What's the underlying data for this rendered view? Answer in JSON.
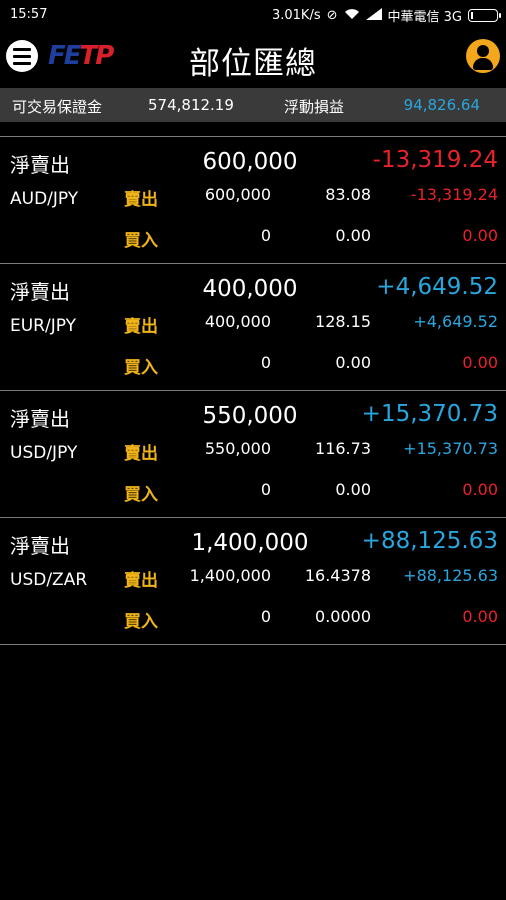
{
  "status_bar": {
    "time": "15:57",
    "speed": "3.01K/s",
    "carrier": "中華電信 3G"
  },
  "header": {
    "title": "部位匯總",
    "logo_text_a": "FE",
    "logo_text_b": "TP"
  },
  "summary": {
    "available_margin_label": "可交易保證金",
    "available_margin_value": "574,812.19",
    "floating_pl_label": "浮動損益",
    "floating_pl_value": "94,826.64"
  },
  "labels": {
    "net_sell": "淨賣出",
    "sell": "賣出",
    "buy": "買入"
  },
  "positions": [
    {
      "pair": "AUD/JPY",
      "net_qty": "600,000",
      "net_pl": "-13,319.24",
      "net_pl_color": "red",
      "sell": {
        "qty": "600,000",
        "price": "83.08",
        "pl": "-13,319.24",
        "pl_color": "red"
      },
      "buy": {
        "qty": "0",
        "price": "0.00",
        "pl": "0.00",
        "pl_color": "red"
      }
    },
    {
      "pair": "EUR/JPY",
      "net_qty": "400,000",
      "net_pl": "+4,649.52",
      "net_pl_color": "blue",
      "sell": {
        "qty": "400,000",
        "price": "128.15",
        "pl": "+4,649.52",
        "pl_color": "blue"
      },
      "buy": {
        "qty": "0",
        "price": "0.00",
        "pl": "0.00",
        "pl_color": "red"
      }
    },
    {
      "pair": "USD/JPY",
      "net_qty": "550,000",
      "net_pl": "+15,370.73",
      "net_pl_color": "blue",
      "sell": {
        "qty": "550,000",
        "price": "116.73",
        "pl": "+15,370.73",
        "pl_color": "blue"
      },
      "buy": {
        "qty": "0",
        "price": "0.00",
        "pl": "0.00",
        "pl_color": "red"
      }
    },
    {
      "pair": "USD/ZAR",
      "net_qty": "1,400,000",
      "net_pl": "+88,125.63",
      "net_pl_color": "blue",
      "sell": {
        "qty": "1,400,000",
        "price": "16.4378",
        "pl": "+88,125.63",
        "pl_color": "blue"
      },
      "buy": {
        "qty": "0",
        "price": "0.0000",
        "pl": "0.00",
        "pl_color": "red"
      }
    }
  ]
}
